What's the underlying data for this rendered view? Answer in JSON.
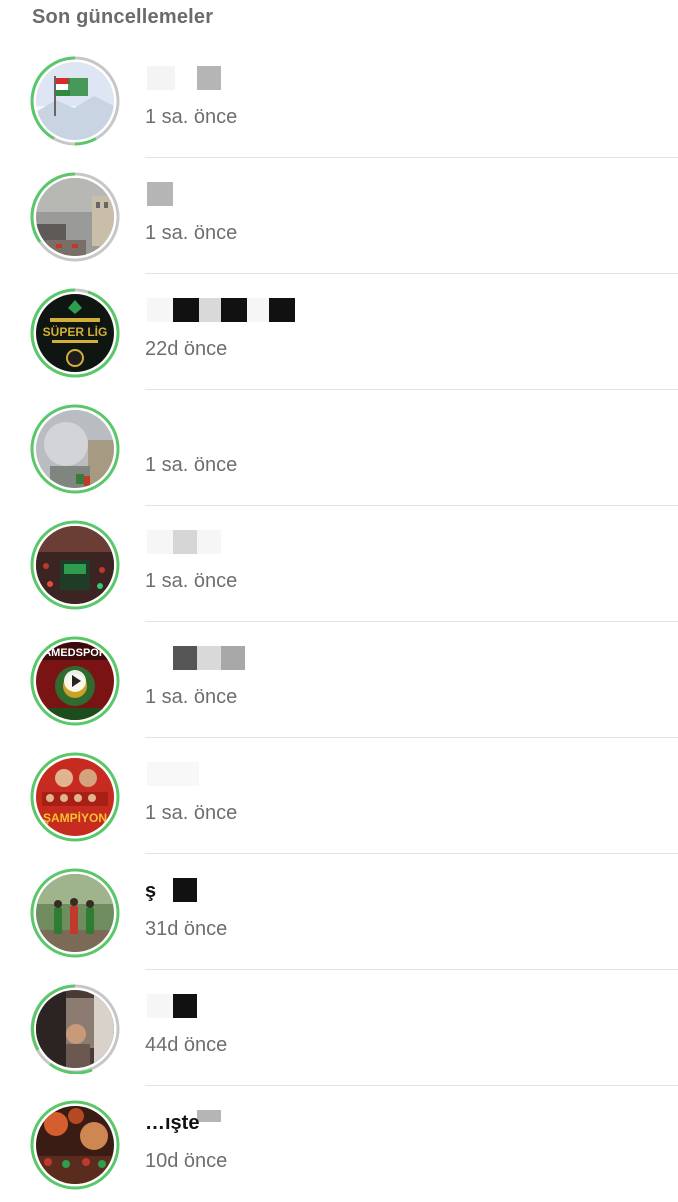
{
  "section": {
    "title": "Son güncellemeler"
  },
  "colors": {
    "ring_unseen": "#5ac86a",
    "ring_seen": "#c7c7c7"
  },
  "updates": [
    {
      "name": "",
      "time": "1 sa. önce",
      "avatar": "flag-snow-photo"
    },
    {
      "name": "",
      "time": "1 sa. önce",
      "avatar": "street-smoke-photo"
    },
    {
      "name": "",
      "time": "22d önce",
      "avatar": "super-lig-badge"
    },
    {
      "name": "",
      "time": "1 sa. önce",
      "avatar": "smoke-photo"
    },
    {
      "name": "",
      "time": "1 sa. önce",
      "avatar": "crowd-bus-photo"
    },
    {
      "name": "",
      "time": "1 sa. önce",
      "avatar": "amedspor-poster",
      "is_video": true
    },
    {
      "name": "",
      "time": "1 sa. önce",
      "avatar": "sampiyon-team-poster"
    },
    {
      "name": "ş",
      "time": "31d önce",
      "avatar": "kids-field-photo"
    },
    {
      "name": "",
      "time": "44d önce",
      "avatar": "celebration-photo"
    },
    {
      "name": "…ışte",
      "time": "10d önce",
      "avatar": "flares-crowd-photo"
    }
  ]
}
